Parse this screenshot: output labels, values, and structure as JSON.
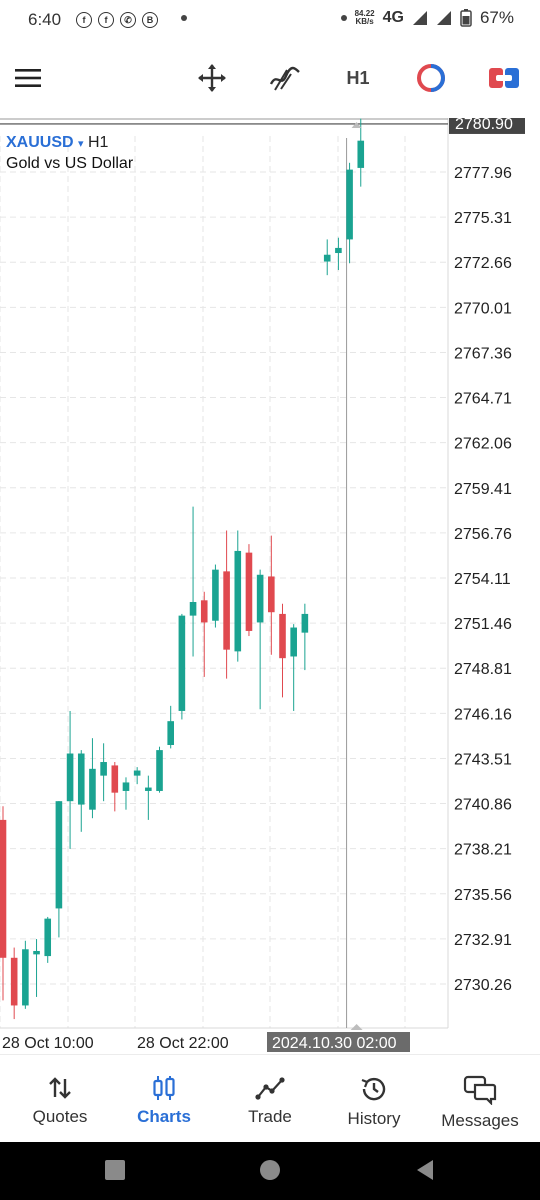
{
  "status_bar": {
    "time": "6:40",
    "app_icons": [
      "facebook-icon",
      "facebook-icon",
      "whatsapp-icon",
      "b-app-icon"
    ],
    "net_speed_value": "84.22",
    "net_speed_unit": "KB/s",
    "network": "4G",
    "battery": "67%"
  },
  "toolbar": {
    "menu_icon": "menu-icon",
    "crosshair_icon": "move-crosshair-icon",
    "indicators_icon": "indicators-icon",
    "timeframe": "H1",
    "oneclick_icon": "one-click-trading-icon",
    "trade_icon": "trade-ticket-icon"
  },
  "chart_header": {
    "symbol": "XAUUSD",
    "arrow": "▾",
    "timeframe": "H1",
    "description": "Gold vs US Dollar"
  },
  "chart_data": {
    "type": "candlestick",
    "symbol": "XAUUSD",
    "timeframe": "H1",
    "current_price": "2780.90",
    "price_axis_labels": [
      "2777.96",
      "2775.31",
      "2772.66",
      "2770.01",
      "2767.36",
      "2764.71",
      "2762.06",
      "2759.41",
      "2756.76",
      "2754.11",
      "2751.46",
      "2748.81",
      "2746.16",
      "2743.51",
      "2740.86",
      "2738.21",
      "2735.56",
      "2732.91",
      "2730.26"
    ],
    "ylim": [
      2728.6,
      2781.5
    ],
    "time_labels": [
      "28 Oct 10:00",
      "28 Oct 22:00"
    ],
    "crosshair_time": "2024.10.30 02:00",
    "candles": [
      {
        "i": 0,
        "o": 2739.9,
        "h": 2740.7,
        "l": 2729.3,
        "c": 2731.8
      },
      {
        "i": 1,
        "o": 2731.8,
        "h": 2732.4,
        "l": 2728.2,
        "c": 2729.0
      },
      {
        "i": 2,
        "o": 2729.0,
        "h": 2732.8,
        "l": 2728.8,
        "c": 2732.3
      },
      {
        "i": 3,
        "o": 2732.0,
        "h": 2732.9,
        "l": 2729.5,
        "c": 2732.2
      },
      {
        "i": 4,
        "o": 2731.9,
        "h": 2734.2,
        "l": 2731.5,
        "c": 2734.1
      },
      {
        "i": 5,
        "o": 2734.7,
        "h": 2741.0,
        "l": 2733.0,
        "c": 2741.0
      },
      {
        "i": 6,
        "o": 2741.0,
        "h": 2746.3,
        "l": 2738.2,
        "c": 2743.8
      },
      {
        "i": 7,
        "o": 2740.8,
        "h": 2744.0,
        "l": 2739.2,
        "c": 2743.8
      },
      {
        "i": 8,
        "o": 2740.5,
        "h": 2744.7,
        "l": 2740.0,
        "c": 2742.9
      },
      {
        "i": 9,
        "o": 2742.5,
        "h": 2744.4,
        "l": 2741.0,
        "c": 2743.3
      },
      {
        "i": 10,
        "o": 2743.1,
        "h": 2743.3,
        "l": 2740.4,
        "c": 2741.5
      },
      {
        "i": 11,
        "o": 2741.6,
        "h": 2742.4,
        "l": 2740.5,
        "c": 2742.1
      },
      {
        "i": 12,
        "o": 2742.5,
        "h": 2743.0,
        "l": 2742.0,
        "c": 2742.8
      },
      {
        "i": 13,
        "o": 2741.6,
        "h": 2742.5,
        "l": 2739.9,
        "c": 2741.8
      },
      {
        "i": 14,
        "o": 2741.6,
        "h": 2744.2,
        "l": 2741.5,
        "c": 2744.0
      },
      {
        "i": 15,
        "o": 2744.3,
        "h": 2746.6,
        "l": 2744.1,
        "c": 2745.7
      },
      {
        "i": 16,
        "o": 2746.3,
        "h": 2752.0,
        "l": 2745.8,
        "c": 2751.9
      },
      {
        "i": 17,
        "o": 2751.9,
        "h": 2758.3,
        "l": 2749.5,
        "c": 2752.7
      },
      {
        "i": 18,
        "o": 2752.8,
        "h": 2753.3,
        "l": 2748.3,
        "c": 2751.5
      },
      {
        "i": 19,
        "o": 2751.6,
        "h": 2754.9,
        "l": 2751.2,
        "c": 2754.6
      },
      {
        "i": 20,
        "o": 2754.5,
        "h": 2756.9,
        "l": 2748.2,
        "c": 2749.9
      },
      {
        "i": 21,
        "o": 2749.8,
        "h": 2756.9,
        "l": 2749.2,
        "c": 2755.7
      },
      {
        "i": 22,
        "o": 2755.6,
        "h": 2756.1,
        "l": 2750.7,
        "c": 2751.0
      },
      {
        "i": 23,
        "o": 2751.5,
        "h": 2754.6,
        "l": 2746.4,
        "c": 2754.3
      },
      {
        "i": 24,
        "o": 2754.2,
        "h": 2756.6,
        "l": 2749.6,
        "c": 2752.1
      },
      {
        "i": 25,
        "o": 2752.0,
        "h": 2752.6,
        "l": 2747.1,
        "c": 2749.4
      },
      {
        "i": 26,
        "o": 2749.5,
        "h": 2751.4,
        "l": 2746.3,
        "c": 2751.2
      },
      {
        "i": 27,
        "o": 2750.9,
        "h": 2752.6,
        "l": 2748.7,
        "c": 2752.0
      },
      {
        "i": 29,
        "o": 2772.7,
        "h": 2774.0,
        "l": 2771.9,
        "c": 2773.1
      },
      {
        "i": 30,
        "o": 2773.2,
        "h": 2774.1,
        "l": 2772.2,
        "c": 2773.5
      },
      {
        "i": 31,
        "o": 2774.0,
        "h": 2778.5,
        "l": 2772.6,
        "c": 2778.1
      },
      {
        "i": 32,
        "o": 2778.2,
        "h": 2781.1,
        "l": 2777.1,
        "c": 2779.8
      }
    ],
    "crosshair_candle": 31,
    "colors": {
      "bull": "#1aa391",
      "bear": "#e0494f",
      "grid": "#e6e6e6",
      "price_label_bg": "#444444",
      "symbol": "#2a6fd6"
    }
  },
  "bottom_nav": {
    "items": [
      {
        "label": "Quotes",
        "icon": "quotes-arrows-icon",
        "active": false
      },
      {
        "label": "Charts",
        "icon": "charts-candles-icon",
        "active": true
      },
      {
        "label": "Trade",
        "icon": "trade-line-icon",
        "active": false
      },
      {
        "label": "History",
        "icon": "history-clock-icon",
        "active": false
      },
      {
        "label": "Messages",
        "icon": "messages-icon",
        "active": false
      }
    ]
  },
  "system_nav": {
    "recent": "recent-apps-icon",
    "home": "home-icon",
    "back": "back-icon"
  }
}
